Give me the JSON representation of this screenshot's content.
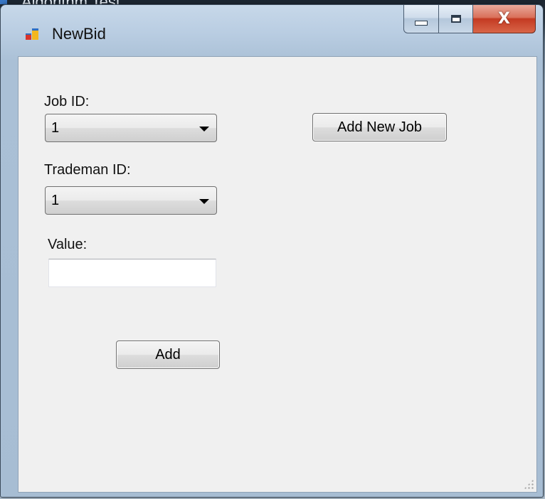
{
  "parent_window": {
    "title": "Algorithm Test"
  },
  "window": {
    "title": "NewBid",
    "controls": {
      "minimize_icon": "minimize-icon",
      "maximize_icon": "maximize-icon",
      "close_icon": "close-icon",
      "close_glyph": "X"
    }
  },
  "form": {
    "job_id": {
      "label": "Job ID:",
      "selected": "1"
    },
    "trademan_id": {
      "label": "Trademan ID:",
      "selected": "1"
    },
    "value": {
      "label": "Value:",
      "text": "",
      "placeholder": ""
    },
    "add_button": "Add",
    "add_new_job_button": "Add New Job"
  },
  "colors": {
    "client_background": "#f0f0f0",
    "close_button": "#c43a22",
    "titlebar": "#b9cde2"
  }
}
